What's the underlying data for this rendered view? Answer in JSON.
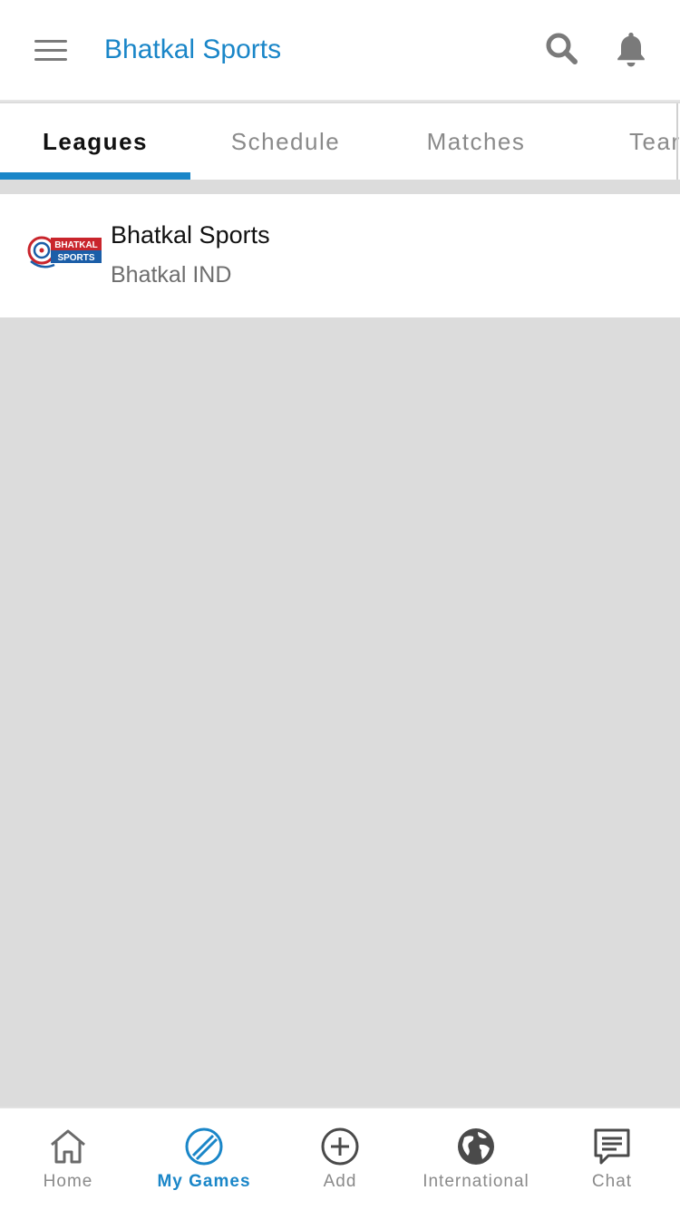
{
  "appbar": {
    "title": "Bhatkal Sports",
    "menu_icon": "hamburger-menu-icon",
    "search_icon": "search-icon",
    "notifications_icon": "bell-icon"
  },
  "tabs": [
    {
      "label": "Leagues",
      "active": true
    },
    {
      "label": "Schedule",
      "active": false
    },
    {
      "label": "Matches",
      "active": false
    },
    {
      "label": "Tear",
      "active": false
    }
  ],
  "leagues": [
    {
      "name": "Bhatkal Sports",
      "location": "Bhatkal IND",
      "logo_text_top": "BHATKAL",
      "logo_text_bottom": "SPORTS"
    }
  ],
  "bottom_nav": [
    {
      "label": "Home",
      "icon": "home-icon",
      "active": false
    },
    {
      "label": "My Games",
      "icon": "cricket-ball-icon",
      "active": true
    },
    {
      "label": "Add",
      "icon": "add-circle-icon",
      "active": false
    },
    {
      "label": "International",
      "icon": "globe-icon",
      "active": false
    },
    {
      "label": "Chat",
      "icon": "chat-icon",
      "active": false
    }
  ],
  "colors": {
    "accent": "#1a86c8",
    "background": "#dcdcdc",
    "surface": "#ffffff",
    "inactive": "#8a8a8a"
  }
}
